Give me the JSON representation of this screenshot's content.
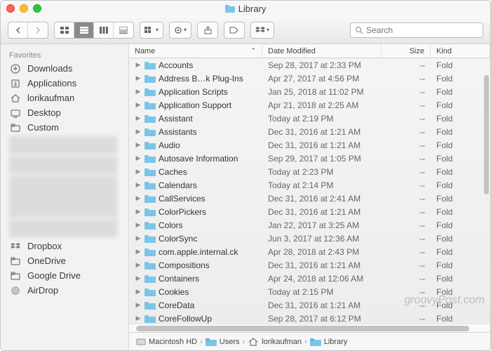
{
  "window": {
    "title": "Library"
  },
  "toolbar": {
    "search_placeholder": "Search"
  },
  "sidebar": {
    "heading": "Favorites",
    "items_top": [
      {
        "label": "Downloads",
        "icon": "downloads"
      },
      {
        "label": "Applications",
        "icon": "applications"
      },
      {
        "label": "lorikaufman",
        "icon": "home"
      },
      {
        "label": "Desktop",
        "icon": "desktop"
      },
      {
        "label": "Custom",
        "icon": "folder"
      }
    ],
    "items_bottom": [
      {
        "label": "Dropbox",
        "icon": "dropbox"
      },
      {
        "label": "OneDrive",
        "icon": "folder"
      },
      {
        "label": "Google Drive",
        "icon": "folder"
      },
      {
        "label": "AirDrop",
        "icon": "airdrop"
      }
    ]
  },
  "columns": {
    "name": "Name",
    "date": "Date Modified",
    "size": "Size",
    "kind": "Kind"
  },
  "rows": [
    {
      "name": "Accounts",
      "date": "Sep 28, 2017 at 2:33 PM",
      "size": "--",
      "kind": "Fold"
    },
    {
      "name": "Address B…k Plug-Ins",
      "date": "Apr 27, 2017 at 4:56 PM",
      "size": "--",
      "kind": "Fold"
    },
    {
      "name": "Application Scripts",
      "date": "Jan 25, 2018 at 11:02 PM",
      "size": "--",
      "kind": "Fold"
    },
    {
      "name": "Application Support",
      "date": "Apr 21, 2018 at 2:25 AM",
      "size": "--",
      "kind": "Fold"
    },
    {
      "name": "Assistant",
      "date": "Today at 2:19 PM",
      "size": "--",
      "kind": "Fold"
    },
    {
      "name": "Assistants",
      "date": "Dec 31, 2016 at 1:21 AM",
      "size": "--",
      "kind": "Fold"
    },
    {
      "name": "Audio",
      "date": "Dec 31, 2016 at 1:21 AM",
      "size": "--",
      "kind": "Fold"
    },
    {
      "name": "Autosave Information",
      "date": "Sep 29, 2017 at 1:05 PM",
      "size": "--",
      "kind": "Fold"
    },
    {
      "name": "Caches",
      "date": "Today at 2:23 PM",
      "size": "--",
      "kind": "Fold"
    },
    {
      "name": "Calendars",
      "date": "Today at 2:14 PM",
      "size": "--",
      "kind": "Fold"
    },
    {
      "name": "CallServices",
      "date": "Dec 31, 2016 at 2:41 AM",
      "size": "--",
      "kind": "Fold"
    },
    {
      "name": "ColorPickers",
      "date": "Dec 31, 2016 at 1:21 AM",
      "size": "--",
      "kind": "Fold"
    },
    {
      "name": "Colors",
      "date": "Jan 22, 2017 at 3:25 AM",
      "size": "--",
      "kind": "Fold"
    },
    {
      "name": "ColorSync",
      "date": "Jun 3, 2017 at 12:36 AM",
      "size": "--",
      "kind": "Fold"
    },
    {
      "name": "com.apple.internal.ck",
      "date": "Apr 28, 2018 at 2:43 PM",
      "size": "--",
      "kind": "Fold"
    },
    {
      "name": "Compositions",
      "date": "Dec 31, 2016 at 1:21 AM",
      "size": "--",
      "kind": "Fold"
    },
    {
      "name": "Containers",
      "date": "Apr 24, 2018 at 12:06 AM",
      "size": "--",
      "kind": "Fold"
    },
    {
      "name": "Cookies",
      "date": "Today at 2:15 PM",
      "size": "--",
      "kind": "Fold"
    },
    {
      "name": "CoreData",
      "date": "Dec 31, 2016 at 1:21 AM",
      "size": "--",
      "kind": "Fold"
    },
    {
      "name": "CoreFollowUp",
      "date": "Sep 28, 2017 at 6:12 PM",
      "size": "--",
      "kind": "Fold"
    }
  ],
  "pathbar": {
    "crumbs": [
      {
        "label": "Macintosh HD",
        "icon": "disk"
      },
      {
        "label": "Users",
        "icon": "folder"
      },
      {
        "label": "lorikaufman",
        "icon": "home"
      },
      {
        "label": "Library",
        "icon": "folder"
      }
    ]
  },
  "watermark": "groovyPost.com"
}
